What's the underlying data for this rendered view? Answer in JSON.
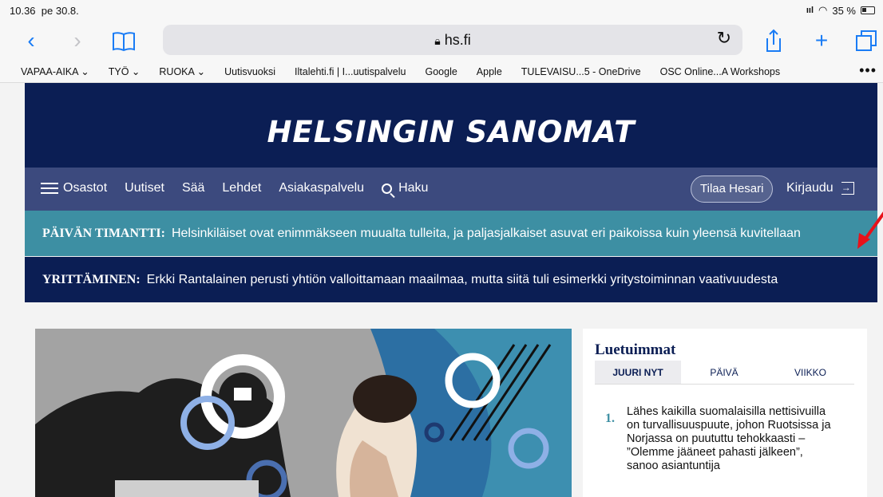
{
  "status": {
    "time": "10.36",
    "date": "pe 30.8.",
    "battery": "35 %"
  },
  "toolbar": {
    "host": "hs.fi"
  },
  "bookmarks": [
    "VAPAA-AIKA ⌄",
    "TYÖ ⌄",
    "RUOKA ⌄",
    "Uutisvuoksi",
    "Iltalehti.fi | I...uutispalvelu",
    "Google",
    "Apple",
    "TULEVAISU...5 - OneDrive",
    "OSC Online...A Workshops"
  ],
  "site": {
    "logo": "HELSINGIN SANOMAT",
    "nav": [
      "Osastot",
      "Uutiset",
      "Sää",
      "Lehdet",
      "Asiakaspalvelu",
      "Haku"
    ],
    "subscribe": "Tilaa Hesari",
    "login": "Kirjaudu"
  },
  "tickers": [
    {
      "label": "PÄIVÄN TIMANTTI:",
      "text": "Helsinkiläiset ovat enimmäkseen muualta tulleita, ja paljasjalkaiset asuvat eri paikoissa kuin yleensä kuvitellaan"
    },
    {
      "label": "YRITTÄMINEN:",
      "text": "Erkki Rantalainen perusti yhtiön valloittamaan maailmaa, mutta siitä tuli esimerkki yritystoiminnan vaativuudesta"
    }
  ],
  "mostread": {
    "title": "Luetuimmat",
    "tabs": [
      "JUURI NYT",
      "PÄIVÄ",
      "VIIKKO"
    ],
    "items": [
      {
        "num": "1.",
        "text": "Lähes kaikilla suomalaisilla nettisivuilla on turvallisuuspuute, johon Ruotsissa ja Norjassa on puututtu tehokkaasti – ”Olemme jääneet pahasti jälkeen”, sanoo asiantuntija"
      }
    ]
  }
}
